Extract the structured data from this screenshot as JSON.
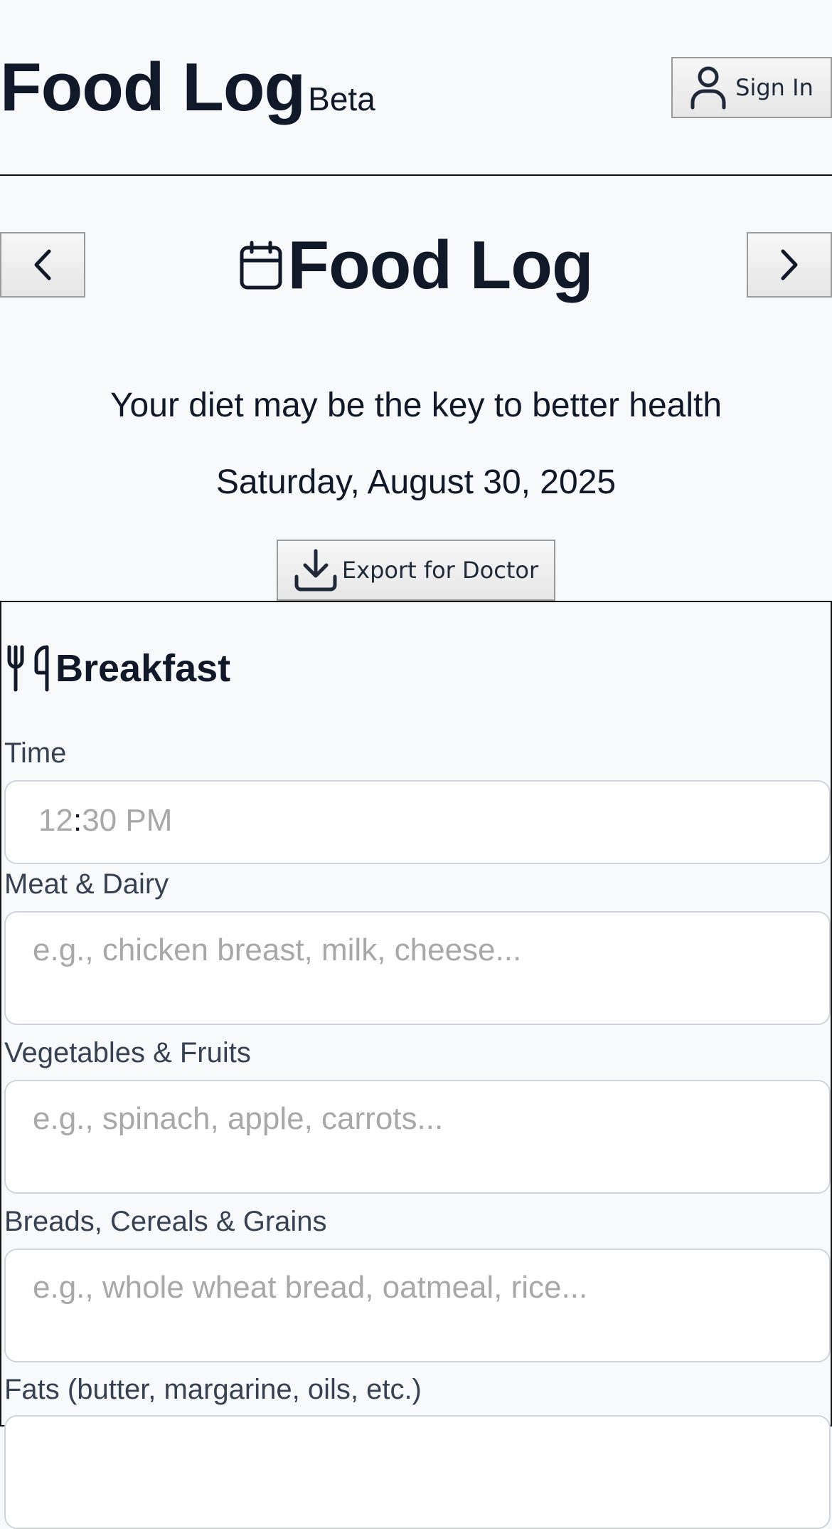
{
  "header": {
    "title": "Food Log",
    "badge": "Beta",
    "sign_in_label": "Sign In"
  },
  "page": {
    "title": "Food Log",
    "tagline": "Your diet may be the key to better health",
    "date": "Saturday, August 30, 2025",
    "export_label": "Export for Doctor"
  },
  "meal": {
    "title": "Breakfast",
    "time_label": "Time",
    "time_hour": "12",
    "time_sep": ":",
    "time_rest": "30 PM",
    "fields": [
      {
        "label": "Meat & Dairy",
        "placeholder": "e.g., chicken breast, milk, cheese..."
      },
      {
        "label": "Vegetables & Fruits",
        "placeholder": "e.g., spinach, apple, carrots..."
      },
      {
        "label": "Breads, Cereals & Grains",
        "placeholder": "e.g., whole wheat bread, oatmeal, rice..."
      },
      {
        "label": "Fats (butter, margarine, oils, etc.)",
        "placeholder": ""
      }
    ]
  },
  "icons": {
    "sign_in": "user-icon",
    "prev": "chevron-left-icon",
    "next": "chevron-right-icon",
    "title": "calendar-icon",
    "export": "download-icon",
    "meal": "utensils-icon"
  }
}
